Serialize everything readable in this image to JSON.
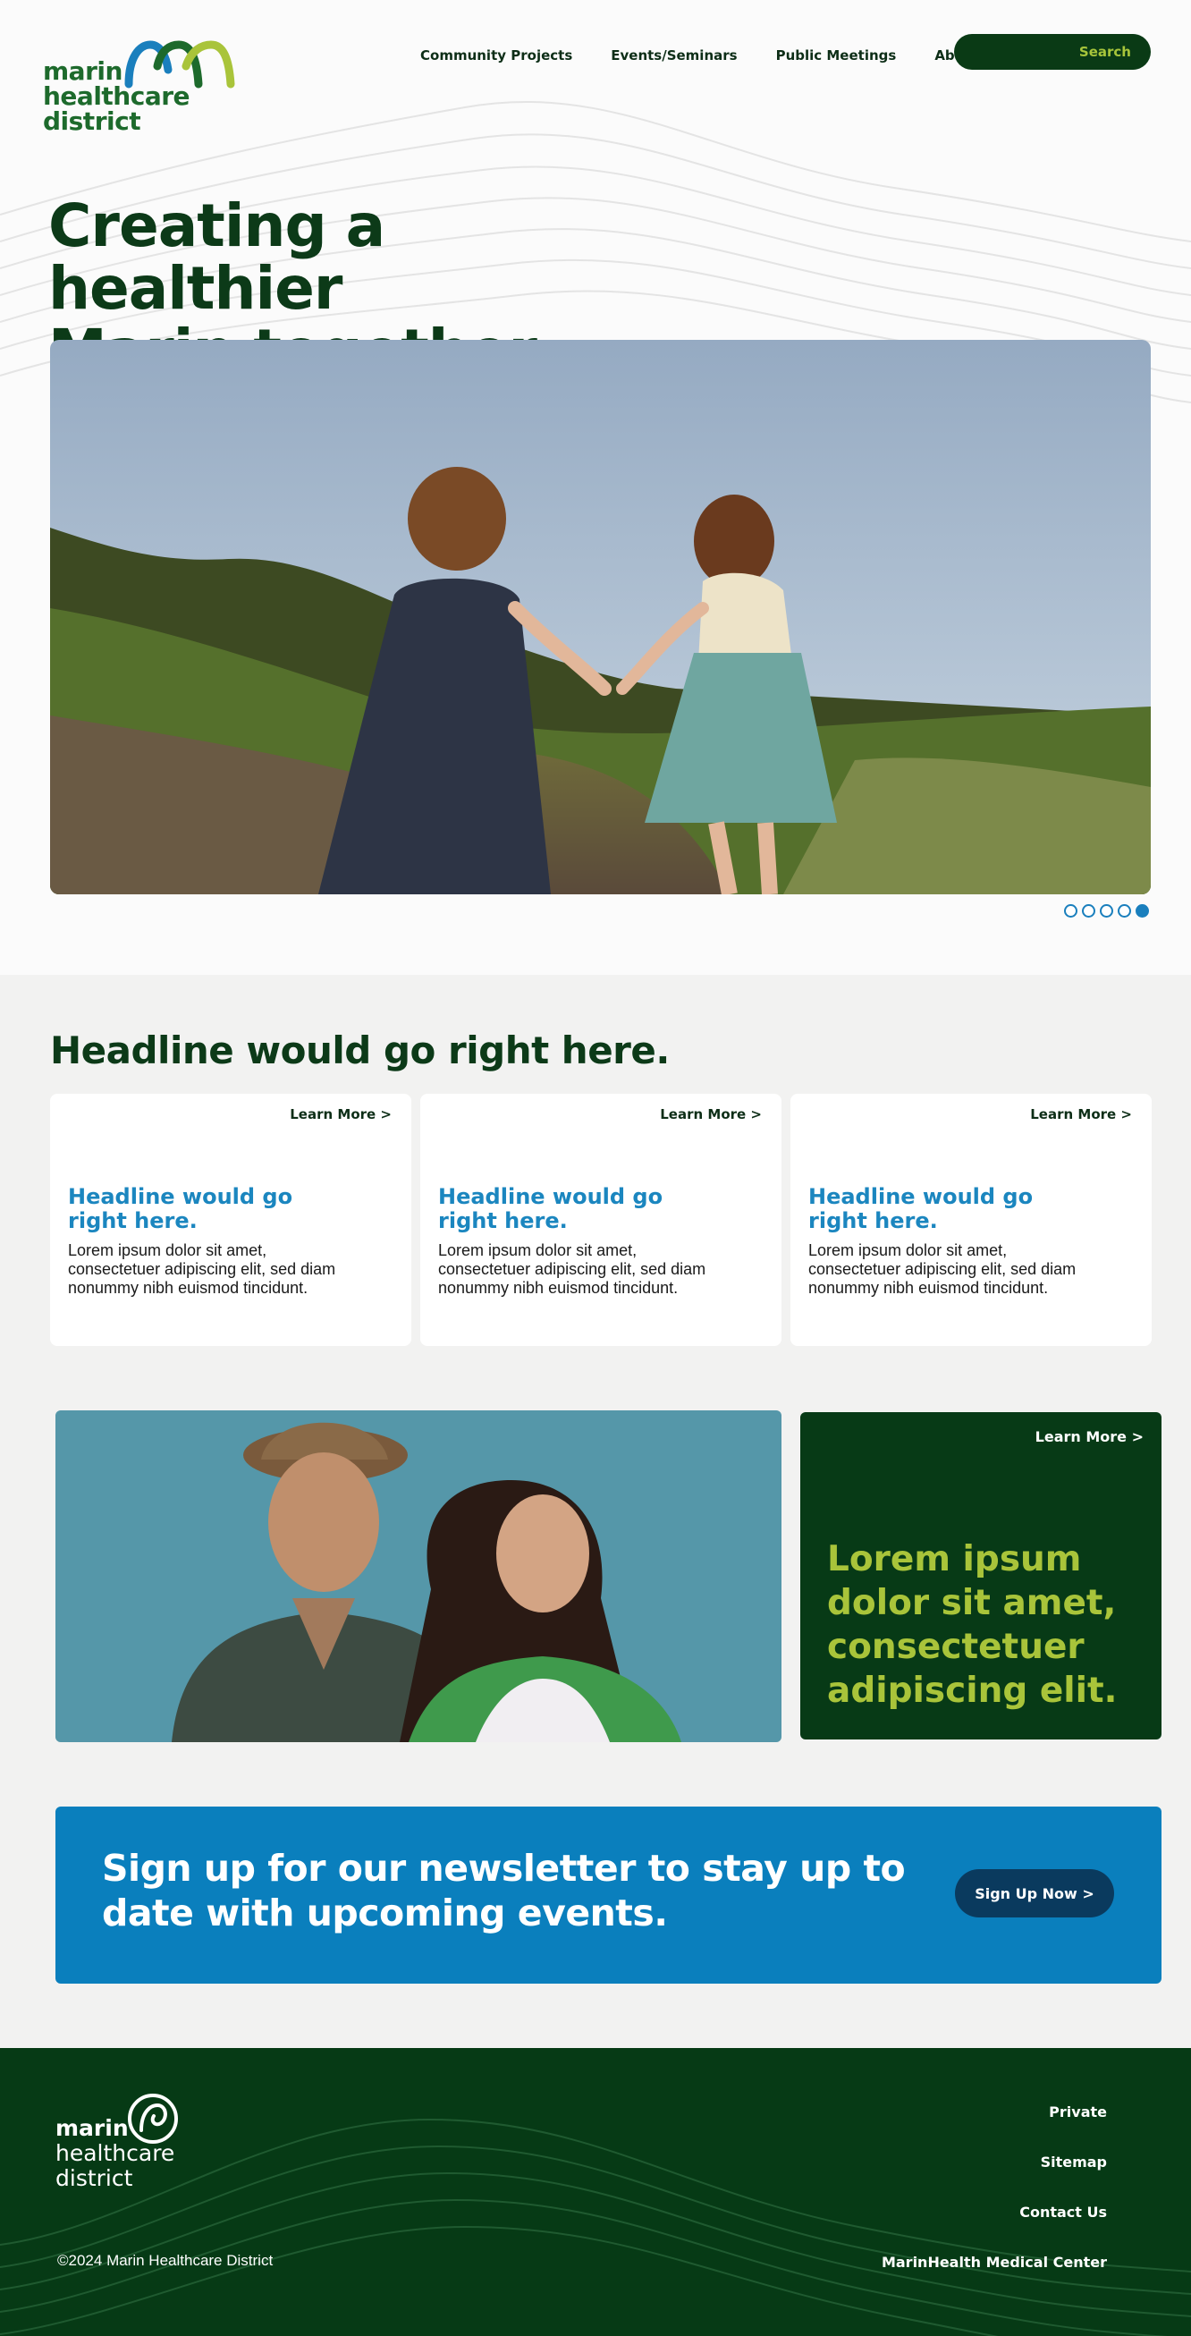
{
  "header": {
    "logo": {
      "line1": "marin",
      "line2": "healthcare",
      "line3": "district"
    },
    "nav": [
      {
        "label": "Community Projects"
      },
      {
        "label": "Events/Seminars"
      },
      {
        "label": "Public Meetings"
      },
      {
        "label": "About Us"
      }
    ],
    "search_label": "Search"
  },
  "hero": {
    "title_line1": "Creating a healthier",
    "title_line2": "Marin together.",
    "slides_total": 5,
    "active_slide": 5
  },
  "section": {
    "headline": "Headline would go right here.",
    "cards": [
      {
        "learn_more": "Learn More >",
        "title": "Headline would go right here.",
        "body": "Lorem ipsum dolor sit amet, consectetuer adipiscing elit, sed diam nonummy nibh euismod tincidunt."
      },
      {
        "learn_more": "Learn More >",
        "title": "Headline would go right here.",
        "body": "Lorem ipsum dolor sit amet, consectetuer adipiscing elit, sed diam nonummy nibh euismod tincidunt."
      },
      {
        "learn_more": "Learn More >",
        "title": "Headline would go right here.",
        "body": "Lorem ipsum dolor sit amet, consectetuer adipiscing elit, sed diam nonummy nibh euismod tincidunt."
      }
    ]
  },
  "promo": {
    "learn_more": "Learn More >",
    "text": "Lorem ipsum dolor sit amet, consectetuer adipiscing elit."
  },
  "newsletter": {
    "text": "Sign up for our newsletter to stay up to date with upcoming events.",
    "button": "Sign Up Now >"
  },
  "footer": {
    "logo": {
      "line1": "marin",
      "line2": "healthcare",
      "line3": "district"
    },
    "copyright": "©2024 Marin Healthcare District",
    "links": [
      {
        "label": "Private"
      },
      {
        "label": "Sitemap"
      },
      {
        "label": "Contact Us"
      },
      {
        "label": "MarinHealth Medical Center"
      }
    ]
  },
  "colors": {
    "brand_dark_green": "#0a3a15",
    "brand_lime": "#a9c43a",
    "brand_blue": "#0a7fbd",
    "headline_blue": "#1b86bf"
  }
}
